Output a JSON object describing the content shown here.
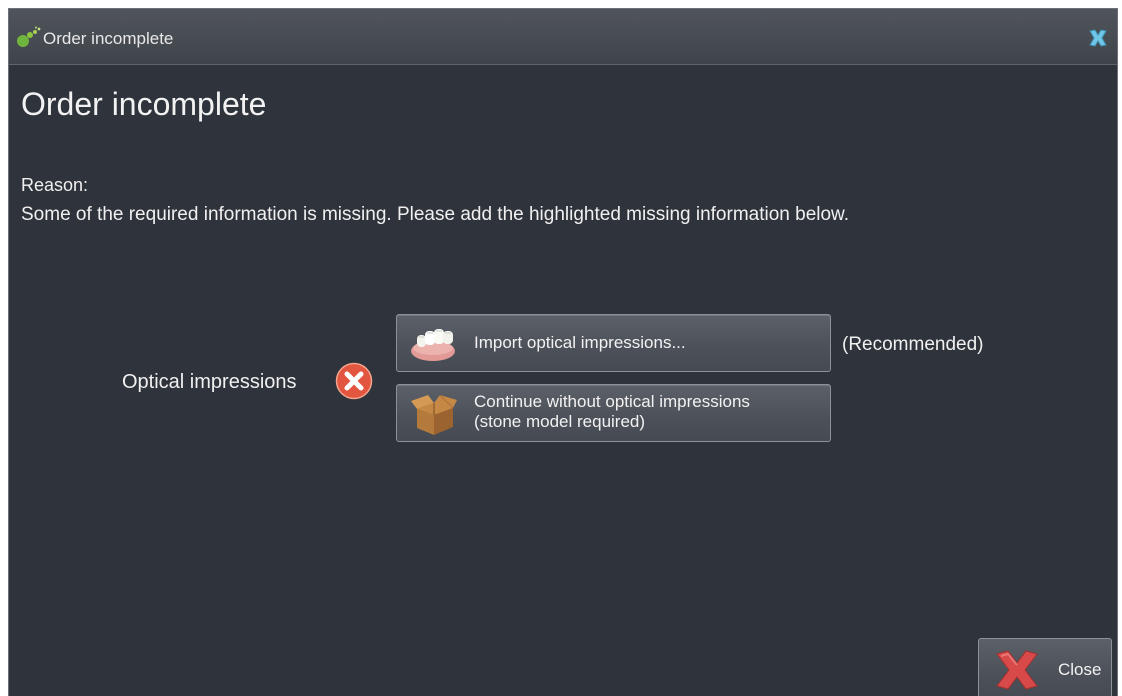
{
  "window": {
    "title": "Order incomplete",
    "title_icon": "app-logo-icon",
    "close_icon": "close-x-icon"
  },
  "main": {
    "heading": "Order incomplete",
    "reason_label": "Reason:",
    "reason_text": "Some of the required information is missing. Please add the highlighted missing information below."
  },
  "requirement": {
    "label": "Optical impressions",
    "status_icon": "error-icon",
    "import_button": {
      "label": "Import optical impressions...",
      "icon": "teeth-model-icon"
    },
    "recommended_note": "(Recommended)",
    "continue_button": {
      "label": "Continue without optical impressions\n(stone model required)",
      "icon": "cardboard-box-icon"
    }
  },
  "footer": {
    "close_label": "Close",
    "close_icon": "close-x-icon"
  },
  "colors": {
    "background": "#2f333b",
    "error": "#e2553f",
    "accent_close": "#d84a4a"
  }
}
